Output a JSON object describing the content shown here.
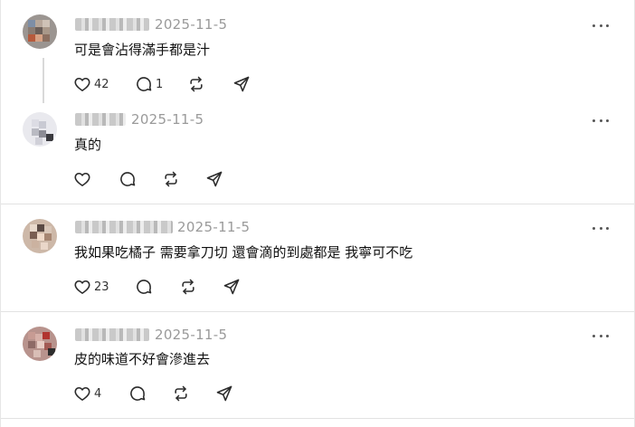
{
  "posts": [
    {
      "date": "2025-11-5",
      "text": "可是會沾得滿手都是汁",
      "likes": "42",
      "replies": "1",
      "reposts": "",
      "shares": ""
    },
    {
      "date": "2025-11-5",
      "text": "真的",
      "likes": "",
      "replies": "",
      "reposts": "",
      "shares": ""
    },
    {
      "date": "2025-11-5",
      "text": "我如果吃橘子 需要拿刀切 還會滴的到處都是 我寧可不吃",
      "likes": "23",
      "replies": "",
      "reposts": "",
      "shares": ""
    },
    {
      "date": "2025-11-5",
      "text": "皮的味道不好會滲進去",
      "likes": "4",
      "replies": "",
      "reposts": "",
      "shares": ""
    }
  ],
  "icons": {
    "like": "heart-icon",
    "reply": "comment-icon",
    "repost": "repost-icon",
    "share": "send-icon",
    "more": "more-icon"
  },
  "colors": {
    "date_text": "#9a9a9a",
    "icon_stroke": "#2b2b2b",
    "divider": "#e2e2e2"
  }
}
